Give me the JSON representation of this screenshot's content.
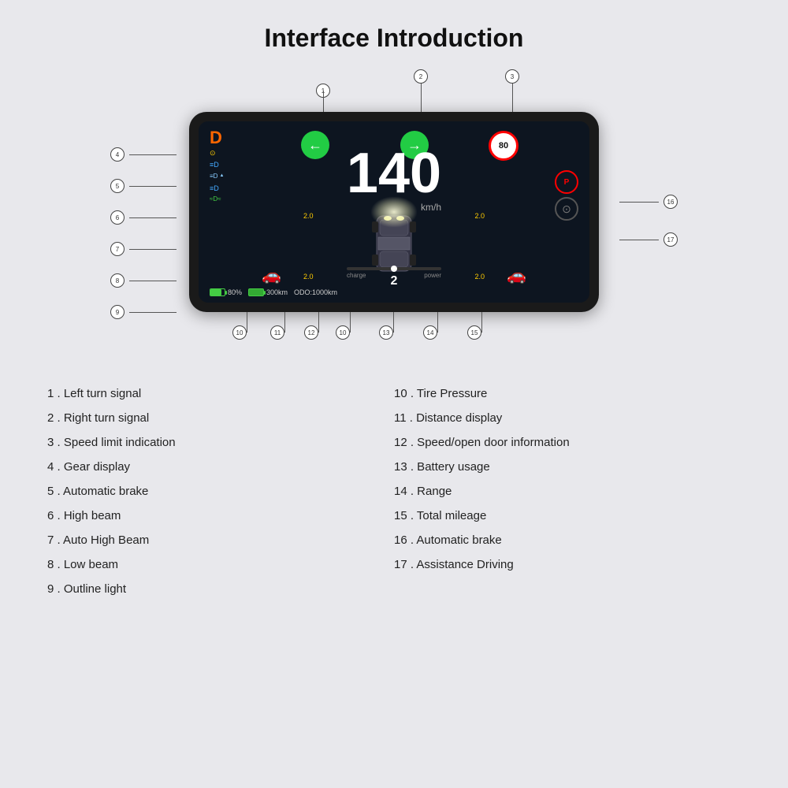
{
  "title": "Interface Introduction",
  "dashboard": {
    "speed": "140",
    "speed_unit": "km/h",
    "gear": "D",
    "speed_limit": "80",
    "battery_pct": "80%",
    "range": "300km",
    "odo": "ODO:1000km",
    "tire_tl": "2.0",
    "tire_tr": "2.0",
    "tire_bl": "2.0",
    "tire_br": "2.0",
    "charge_label": "charge",
    "power_label": "power",
    "door_num": "2"
  },
  "labels_left": [
    {
      "num": "1",
      "text": "Left turn signal"
    },
    {
      "num": "2",
      "text": "Right turn signal"
    },
    {
      "num": "3",
      "text": "Speed limit indication"
    },
    {
      "num": "4",
      "text": "Gear display"
    },
    {
      "num": "5",
      "text": "Automatic brake"
    },
    {
      "num": "6",
      "text": "High beam"
    },
    {
      "num": "7",
      "text": "Auto High Beam"
    },
    {
      "num": "8",
      "text": "Low beam"
    },
    {
      "num": "9",
      "text": "Outline light"
    }
  ],
  "labels_right": [
    {
      "num": "10",
      "text": "Tire Pressure"
    },
    {
      "num": "11",
      "text": "Distance display"
    },
    {
      "num": "12",
      "text": "Speed/open door information"
    },
    {
      "num": "13",
      "text": "Battery usage"
    },
    {
      "num": "14",
      "text": "Range"
    },
    {
      "num": "15",
      "text": "Total mileage"
    },
    {
      "num": "16",
      "text": "Automatic brake"
    },
    {
      "num": "17",
      "text": "Assistance Driving"
    }
  ]
}
